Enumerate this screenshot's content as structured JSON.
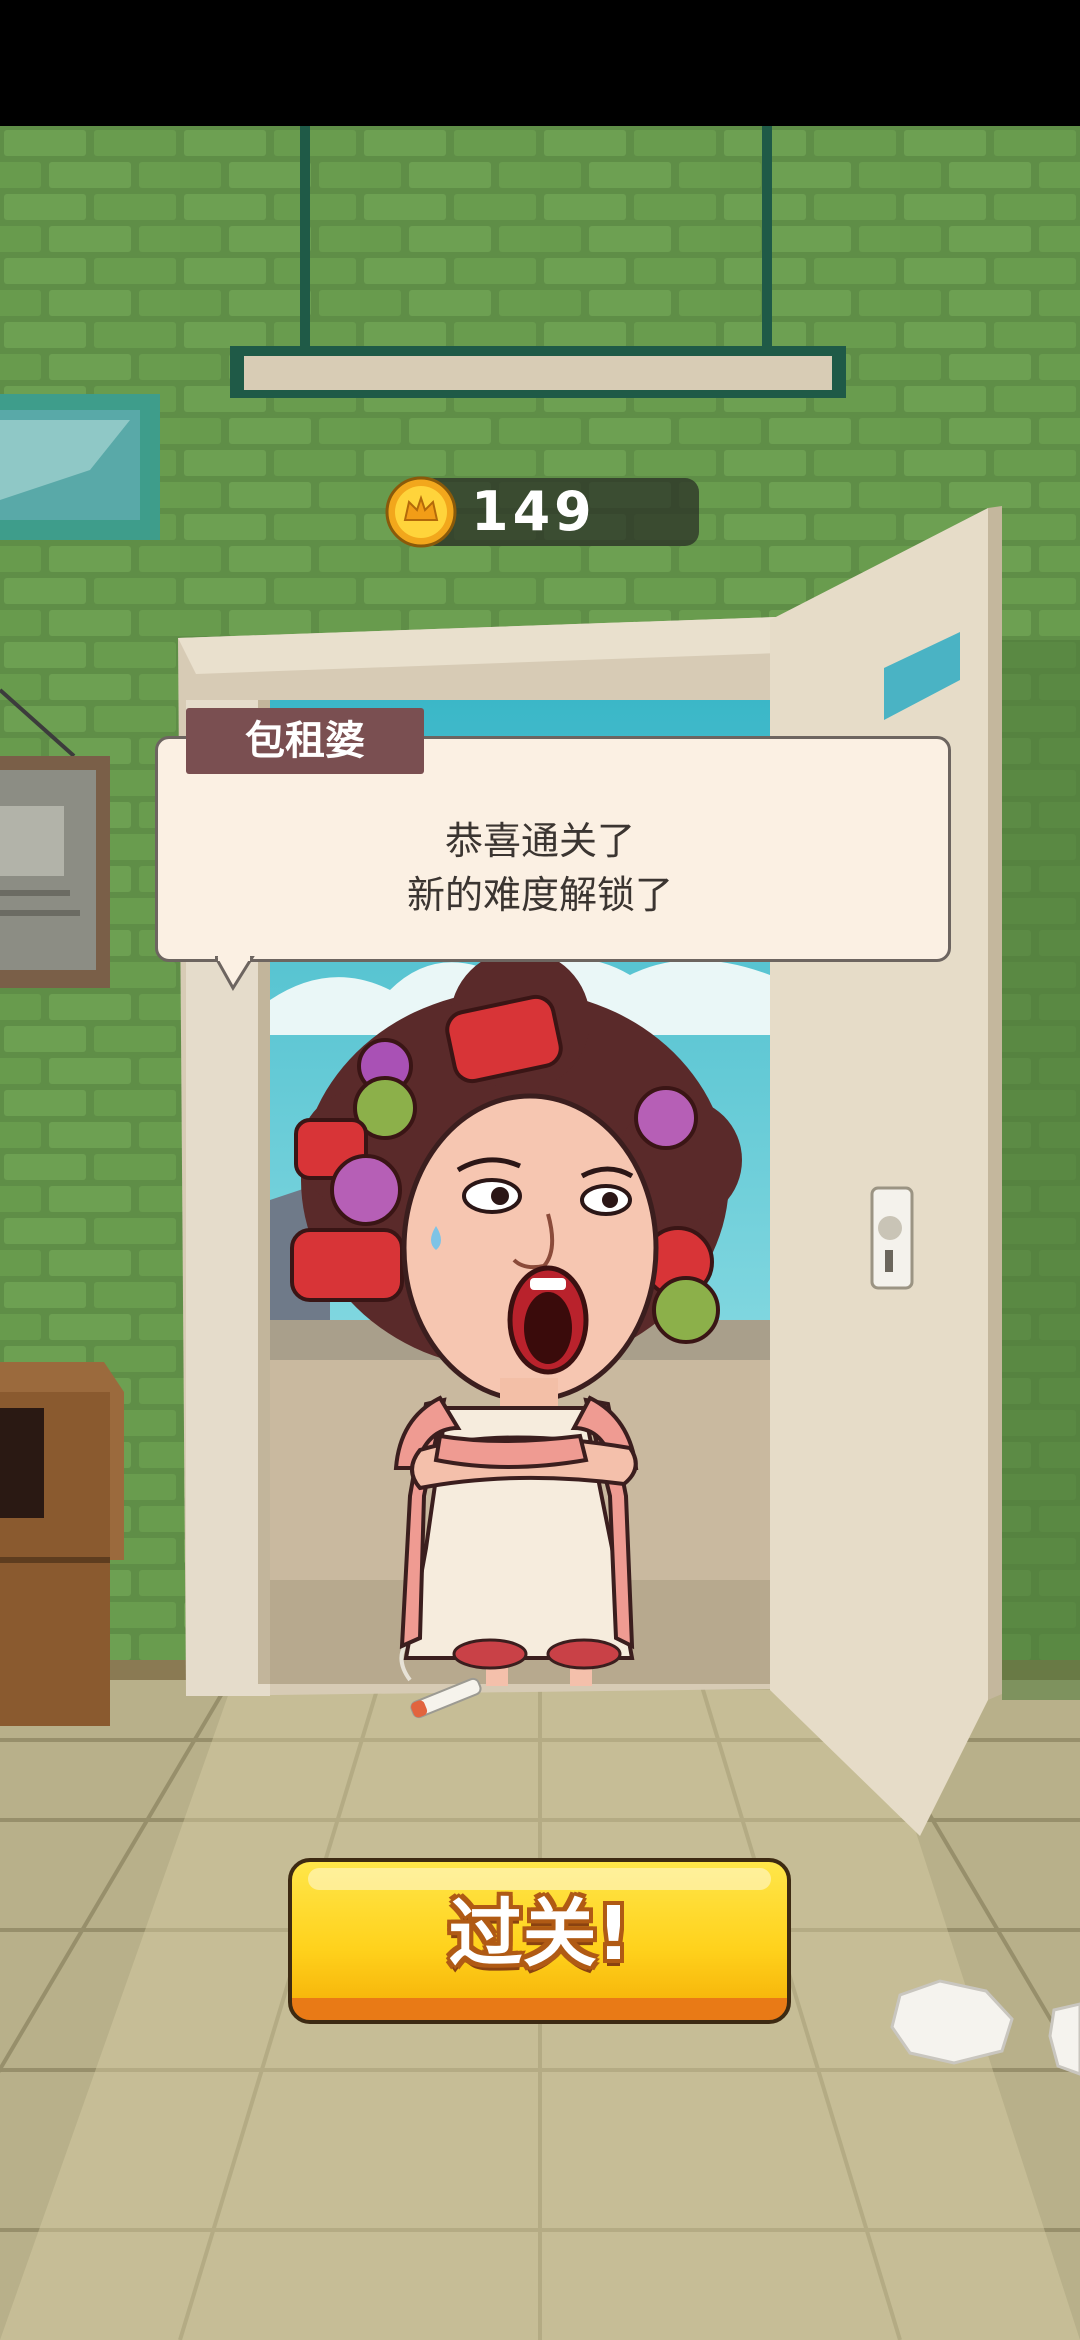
{
  "coins": {
    "count": "149",
    "icon": "crown-coin-icon"
  },
  "dialog": {
    "speaker": "包租婆",
    "line1": "恭喜通关了",
    "line2": "新的难度解锁了"
  },
  "pass_button": {
    "label": "过关!"
  },
  "colors": {
    "wall": "#6b9a4f",
    "floor": "#bbb48c",
    "button_yellow": "#ffd21c",
    "button_orange": "#e97a16",
    "speaker_tag": "#7a4f51",
    "dialog_bg": "#fbf0e3"
  }
}
